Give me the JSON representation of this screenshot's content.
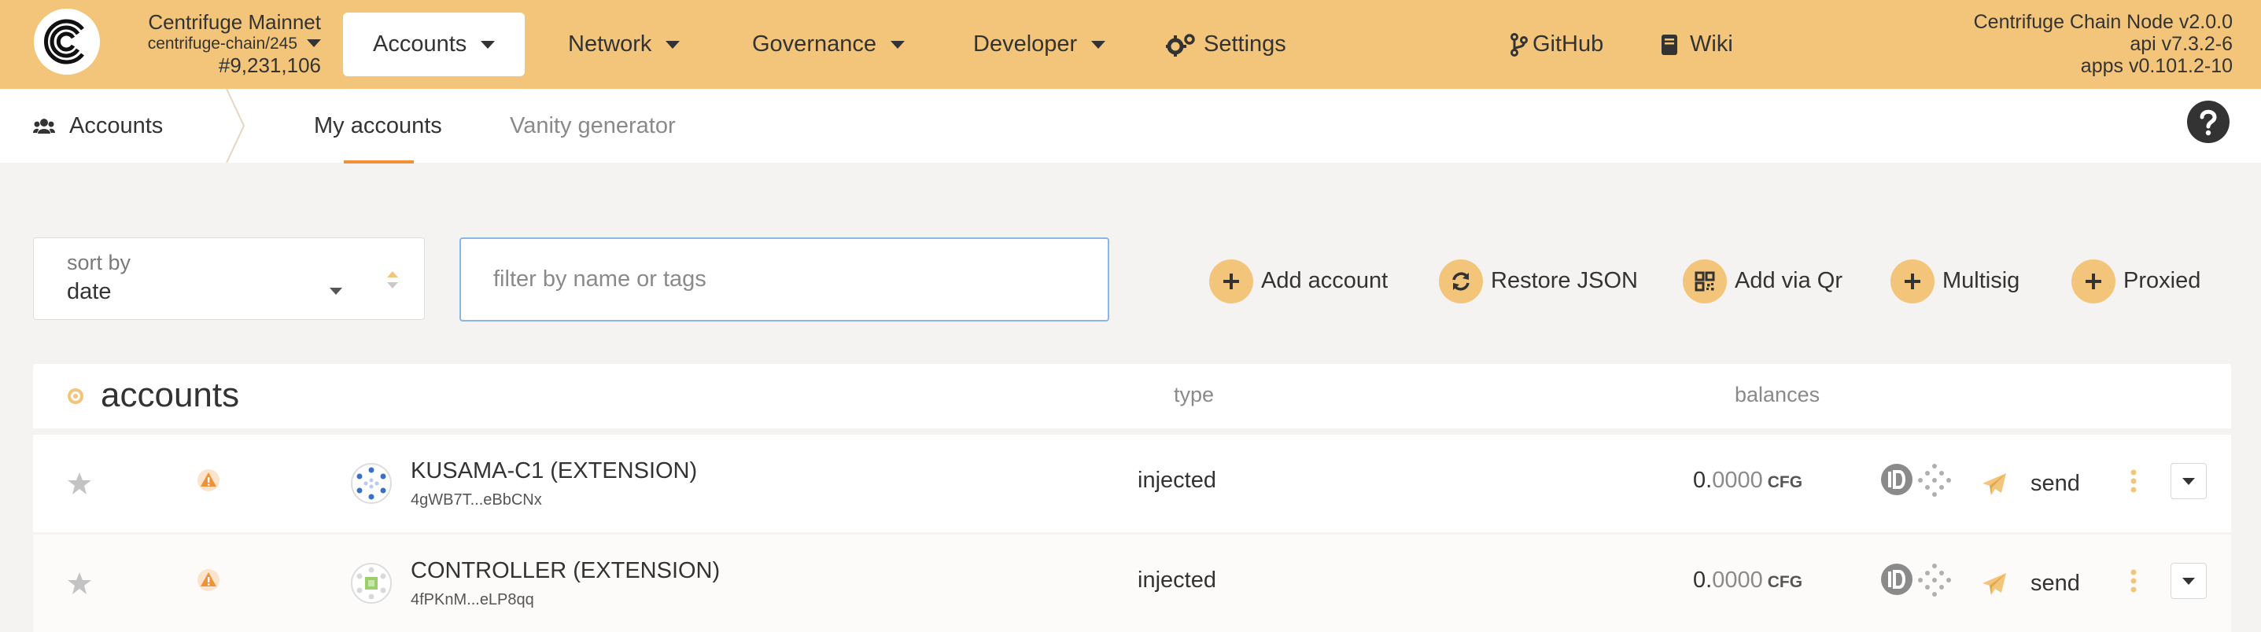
{
  "chain": {
    "name": "Centrifuge Mainnet",
    "spec": "centrifuge-chain/245",
    "block": "#9,231,106"
  },
  "nav": {
    "accounts": "Accounts",
    "network": "Network",
    "governance": "Governance",
    "developer": "Developer",
    "settings": "Settings",
    "github": "GitHub",
    "wiki": "Wiki"
  },
  "node": {
    "name": "Centrifuge Chain Node v2.0.0",
    "api": "api v7.3.2-6",
    "apps": "apps v0.101.2-10"
  },
  "tabs": {
    "section": "Accounts",
    "my_accounts": "My accounts",
    "vanity": "Vanity generator"
  },
  "controls": {
    "sort_label": "sort by",
    "sort_value": "date",
    "filter_placeholder": "filter by name or tags",
    "add_account": "Add account",
    "restore_json": "Restore JSON",
    "add_via_qr": "Add via Qr",
    "multisig": "Multisig",
    "proxied": "Proxied"
  },
  "table": {
    "title": "accounts",
    "col_type": "type",
    "col_balances": "balances",
    "rows": [
      {
        "name": "KUSAMA-C1 (EXTENSION)",
        "address": "4gWB7T...eBbCNx",
        "type": "injected",
        "balance_int": "0.",
        "balance_dec": "0000",
        "unit": "CFG",
        "send": "send"
      },
      {
        "name": "CONTROLLER (EXTENSION)",
        "address": "4fPKnM...eLP8qq",
        "type": "injected",
        "balance_int": "0.",
        "balance_dec": "0000",
        "unit": "CFG",
        "send": "send"
      }
    ]
  },
  "colors": {
    "accent": "#f3c57a",
    "warning": "#f19135",
    "tab_underline": "#f19135"
  }
}
